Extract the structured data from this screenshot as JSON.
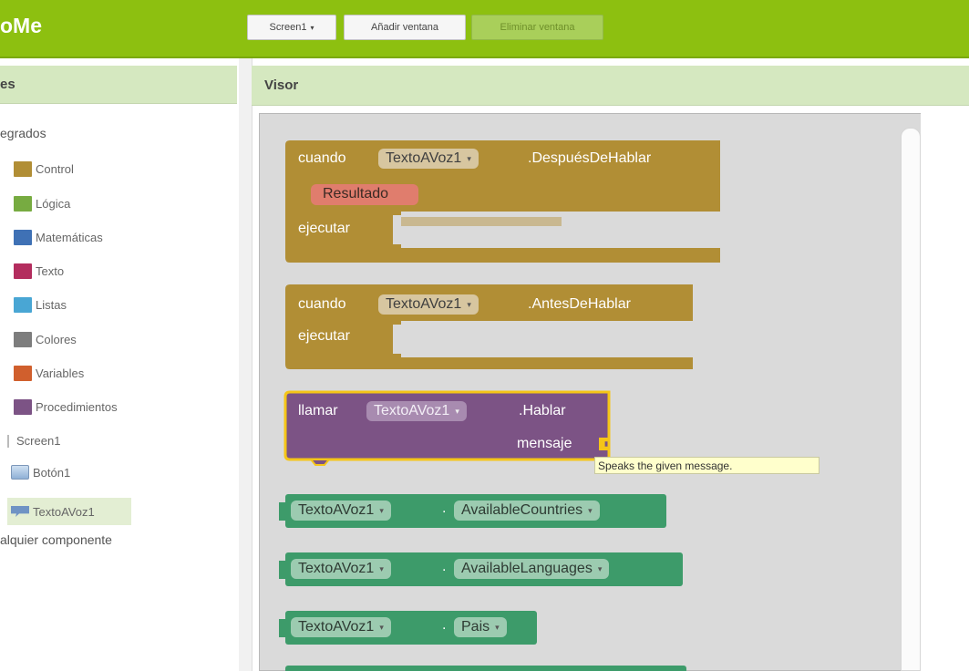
{
  "app": {
    "title": "oMe"
  },
  "toolbar": {
    "screen_select": "Screen1",
    "screen_arrow": "▾",
    "add_window": "Añadir ventana",
    "remove_window": "Eliminar ventana"
  },
  "left_panel": {
    "header": "es",
    "builtin_heading": "egrados",
    "builtin_items": [
      {
        "label": "Control",
        "color": "#b18e35"
      },
      {
        "label": "Lógica",
        "color": "#77ab41"
      },
      {
        "label": "Matemáticas",
        "color": "#3f71b5"
      },
      {
        "label": "Texto",
        "color": "#b32d5e"
      },
      {
        "label": "Listas",
        "color": "#49a6d4"
      },
      {
        "label": "Colores",
        "color": "#7d7d7d"
      },
      {
        "label": "Variables",
        "color": "#d05f2d"
      },
      {
        "label": "Procedimientos",
        "color": "#7c5385"
      }
    ],
    "screen": "Screen1",
    "components": [
      {
        "label": "Botón1",
        "icon": "button-icon"
      },
      {
        "label": "TextoAVoz1",
        "icon": "speech-icon"
      }
    ],
    "any_component": "alquier componente"
  },
  "viewer": {
    "header": "Visor",
    "blocks": {
      "event1": {
        "when": "cuando",
        "component": "TextoAVoz1",
        "event": ".DespuésDeHablar",
        "param": "Resultado",
        "do": "ejecutar"
      },
      "event2": {
        "when": "cuando",
        "component": "TextoAVoz1",
        "event": ".AntesDeHablar",
        "do": "ejecutar"
      },
      "call": {
        "call": "llamar",
        "component": "TextoAVoz1",
        "method": ".Hablar",
        "arg": "mensaje"
      },
      "tooltip": "Speaks the given message.",
      "getters": [
        {
          "component": "TextoAVoz1",
          "dot": ".",
          "property": "AvailableCountries"
        },
        {
          "component": "TextoAVoz1",
          "dot": ".",
          "property": "AvailableLanguages"
        },
        {
          "component": "TextoAVoz1",
          "dot": ".",
          "property": "Pais"
        }
      ],
      "dropdown_arrow": "▾"
    }
  },
  "colors": {
    "topbar": "#8dc010",
    "event_block": "#b18e35",
    "procedure_block": "#7c5385",
    "getter_block": "#3d9b6a",
    "selection": "#f5c518"
  }
}
